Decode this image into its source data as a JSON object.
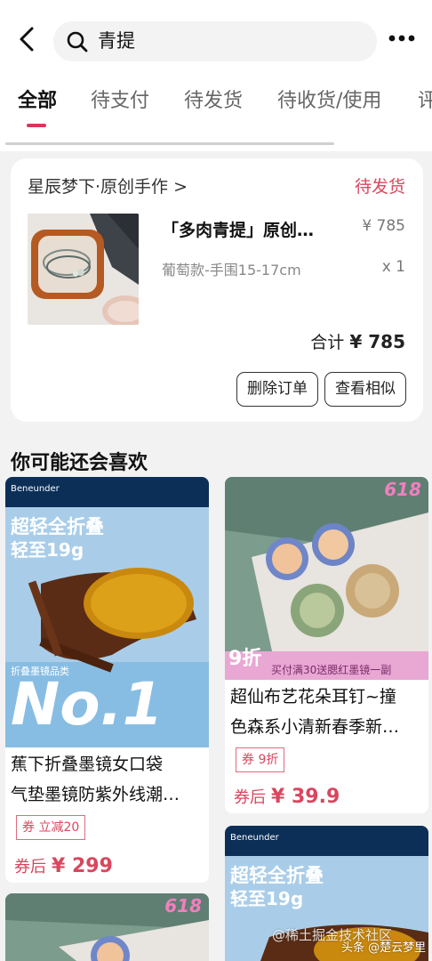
{
  "search": {
    "query": "青提"
  },
  "tabs": [
    "全部",
    "待支付",
    "待发货",
    "待收货/使用",
    "评"
  ],
  "order": {
    "shop": "星辰梦下·原创手作 >",
    "status": "待发货",
    "product_name": "「多肉青提」原创…",
    "price": "¥ 785",
    "spec": "葡萄款-手围15-17cm",
    "qty": "x 1",
    "total_label": "合计",
    "total_value": "¥ 785",
    "delete_label": "删除订单",
    "similar_label": "查看相似"
  },
  "recommend": {
    "title": "你可能还会喜欢",
    "items": [
      {
        "brand": "Beneunder",
        "ad_line1": "超轻全折叠",
        "ad_line2": "轻至19g",
        "ad_badge": "折叠墨镜品类",
        "ad_big": "No.1",
        "title_line1": "蕉下折叠墨镜女口袋",
        "title_line2": "气垫墨镜防紫外线潮…",
        "coupon": "券 立减20",
        "price_label": "券后",
        "price": "¥ 299"
      },
      {
        "promo": "618",
        "discount": "9折",
        "banner": "买付满30送腮红墨镜一副",
        "title_line1": "超仙布艺花朵耳钉~撞",
        "title_line2": "色森系小清新春季新…",
        "coupon": "券 9折",
        "price_label": "券后",
        "price": "¥ 39.9"
      },
      {
        "promo": "618"
      },
      {
        "brand": "Beneunder",
        "ad_line1": "超轻全折叠",
        "ad_line2": "轻至19g"
      }
    ]
  },
  "watermark": {
    "line1": "@稀土掘金技术社区",
    "line2": "头条 @楚云梦里"
  },
  "colors": {
    "accent": "#d8475e",
    "indicator": "#e0325a"
  }
}
